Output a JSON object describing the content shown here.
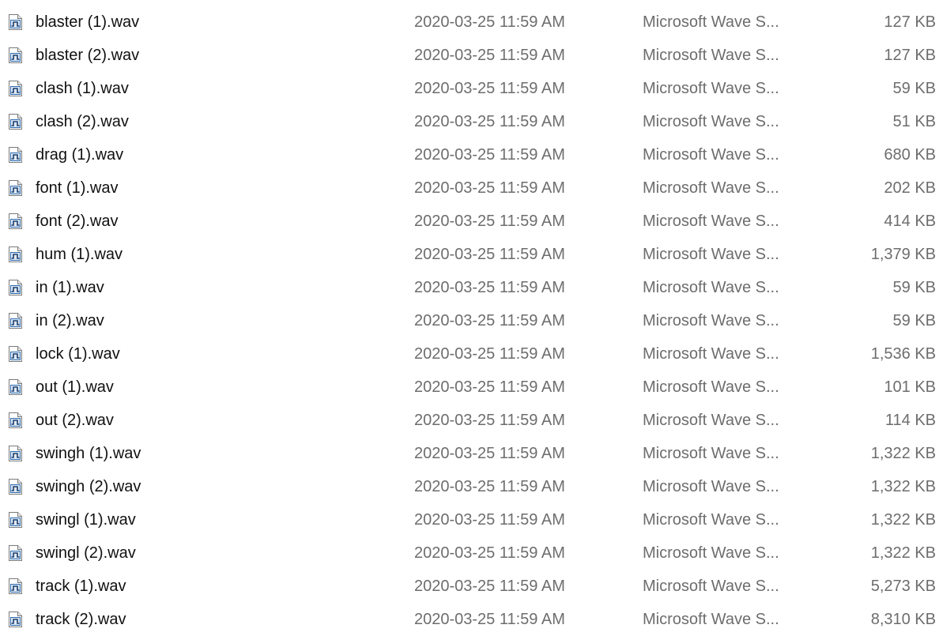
{
  "files": [
    {
      "name": "blaster (1).wav",
      "date": "2020-03-25 11:59 AM",
      "type": "Microsoft Wave S...",
      "size": "127 KB",
      "icon": "wave-audio-file-icon"
    },
    {
      "name": "blaster (2).wav",
      "date": "2020-03-25 11:59 AM",
      "type": "Microsoft Wave S...",
      "size": "127 KB",
      "icon": "wave-audio-file-icon"
    },
    {
      "name": "clash (1).wav",
      "date": "2020-03-25 11:59 AM",
      "type": "Microsoft Wave S...",
      "size": "59 KB",
      "icon": "wave-audio-file-icon"
    },
    {
      "name": "clash (2).wav",
      "date": "2020-03-25 11:59 AM",
      "type": "Microsoft Wave S...",
      "size": "51 KB",
      "icon": "wave-audio-file-icon"
    },
    {
      "name": "drag (1).wav",
      "date": "2020-03-25 11:59 AM",
      "type": "Microsoft Wave S...",
      "size": "680 KB",
      "icon": "wave-audio-file-icon"
    },
    {
      "name": "font (1).wav",
      "date": "2020-03-25 11:59 AM",
      "type": "Microsoft Wave S...",
      "size": "202 KB",
      "icon": "wave-audio-file-icon"
    },
    {
      "name": "font (2).wav",
      "date": "2020-03-25 11:59 AM",
      "type": "Microsoft Wave S...",
      "size": "414 KB",
      "icon": "wave-audio-file-icon"
    },
    {
      "name": "hum (1).wav",
      "date": "2020-03-25 11:59 AM",
      "type": "Microsoft Wave S...",
      "size": "1,379 KB",
      "icon": "wave-audio-file-icon"
    },
    {
      "name": "in (1).wav",
      "date": "2020-03-25 11:59 AM",
      "type": "Microsoft Wave S...",
      "size": "59 KB",
      "icon": "wave-audio-file-icon"
    },
    {
      "name": "in (2).wav",
      "date": "2020-03-25 11:59 AM",
      "type": "Microsoft Wave S...",
      "size": "59 KB",
      "icon": "wave-audio-file-icon"
    },
    {
      "name": "lock (1).wav",
      "date": "2020-03-25 11:59 AM",
      "type": "Microsoft Wave S...",
      "size": "1,536 KB",
      "icon": "wave-audio-file-icon"
    },
    {
      "name": "out (1).wav",
      "date": "2020-03-25 11:59 AM",
      "type": "Microsoft Wave S...",
      "size": "101 KB",
      "icon": "wave-audio-file-icon"
    },
    {
      "name": "out (2).wav",
      "date": "2020-03-25 11:59 AM",
      "type": "Microsoft Wave S...",
      "size": "114 KB",
      "icon": "wave-audio-file-icon"
    },
    {
      "name": "swingh (1).wav",
      "date": "2020-03-25 11:59 AM",
      "type": "Microsoft Wave S...",
      "size": "1,322 KB",
      "icon": "wave-audio-file-icon"
    },
    {
      "name": "swingh (2).wav",
      "date": "2020-03-25 11:59 AM",
      "type": "Microsoft Wave S...",
      "size": "1,322 KB",
      "icon": "wave-audio-file-icon"
    },
    {
      "name": "swingl (1).wav",
      "date": "2020-03-25 11:59 AM",
      "type": "Microsoft Wave S...",
      "size": "1,322 KB",
      "icon": "wave-audio-file-icon"
    },
    {
      "name": "swingl (2).wav",
      "date": "2020-03-25 11:59 AM",
      "type": "Microsoft Wave S...",
      "size": "1,322 KB",
      "icon": "wave-audio-file-icon"
    },
    {
      "name": "track (1).wav",
      "date": "2020-03-25 11:59 AM",
      "type": "Microsoft Wave S...",
      "size": "5,273 KB",
      "icon": "wave-audio-file-icon"
    },
    {
      "name": "track (2).wav",
      "date": "2020-03-25 11:59 AM",
      "type": "Microsoft Wave S...",
      "size": "8,310 KB",
      "icon": "wave-audio-file-icon"
    }
  ],
  "colors": {
    "name_text": "#111111",
    "detail_text": "#6d6d6d",
    "icon_blue": "#2b6cb0"
  }
}
